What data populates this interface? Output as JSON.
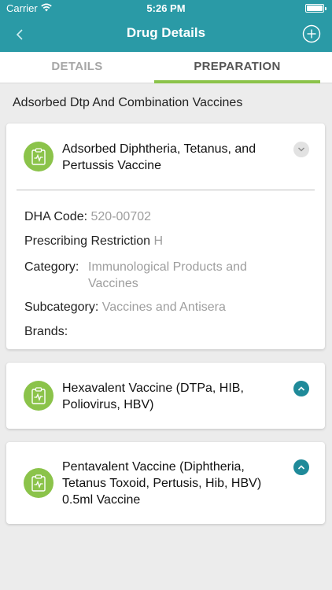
{
  "status": {
    "carrier": "Carrier",
    "time": "5:26 PM"
  },
  "nav": {
    "title": "Drug Details"
  },
  "tabs": [
    {
      "label": "DETAILS"
    },
    {
      "label": "PREPARATION"
    }
  ],
  "section_title": "Adsorbed Dtp And Combination Vaccines",
  "cards": [
    {
      "name": "Adsorbed Diphtheria, Tetanus, and Pertussis Vaccine",
      "expanded": true,
      "details": {
        "dha_label": "DHA Code:",
        "dha_value": "520-00702",
        "restriction_label": "Prescribing Restriction",
        "restriction_value": "H",
        "category_label": "Category:",
        "category_value": "Immunological Products and Vaccines",
        "subcategory_label": "Subcategory:",
        "subcategory_value": "Vaccines and Antisera",
        "brands_label": "Brands:"
      }
    },
    {
      "name": "Hexavalent Vaccine (DTPa, HIB, Poliovirus, HBV)",
      "expanded": false
    },
    {
      "name": "Pentavalent Vaccine (Diphtheria, Tetanus Toxoid, Pertusis, Hib, HBV) 0.5ml Vaccine",
      "expanded": false
    }
  ],
  "colors": {
    "header": "#2a9aa6",
    "accent_green": "#8bc34a",
    "toggle_teal": "#1f8a99"
  },
  "icons": {
    "back": "chevron-left-icon",
    "add": "plus-circle-icon",
    "drug": "clipboard-pulse-icon"
  }
}
